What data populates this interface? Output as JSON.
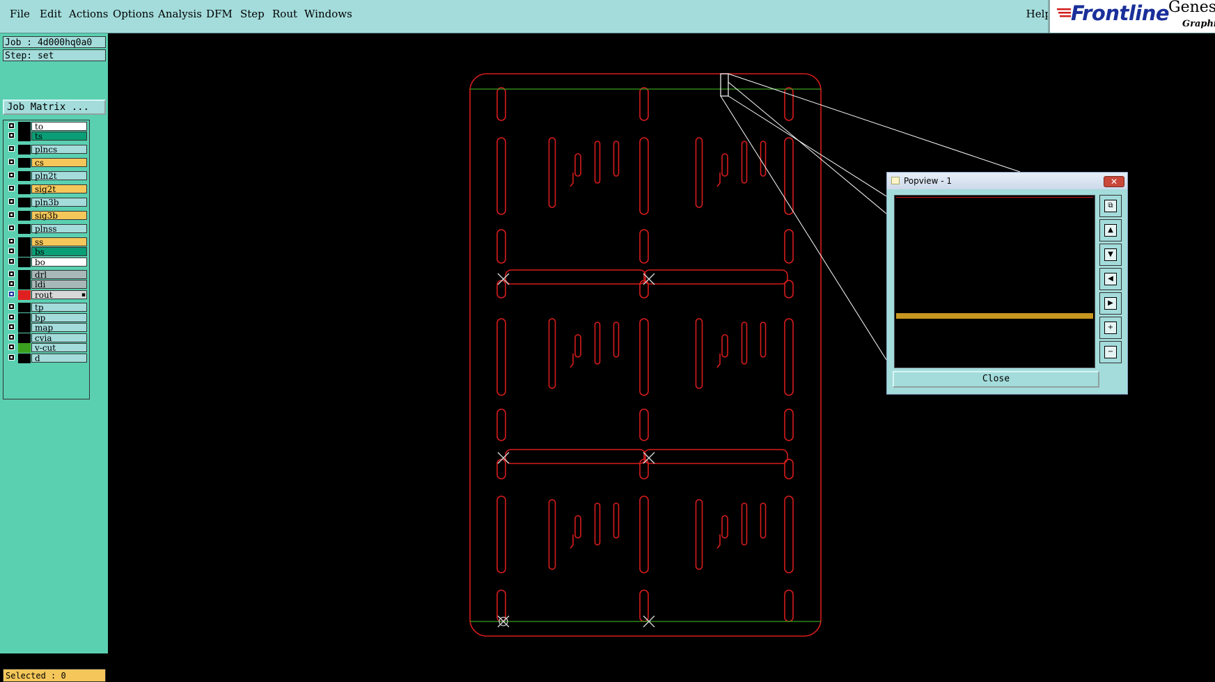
{
  "menu": {
    "file": "File",
    "edit": "Edit",
    "actions": "Actions",
    "options": "Options",
    "analysis": "Analysis",
    "dfm": "DFM",
    "step": "Step",
    "rout": "Rout",
    "windows": "Windows",
    "help": "Help"
  },
  "logo": {
    "brand": "Frontline",
    "product": "Genesis",
    "sub": "Graphic"
  },
  "job": {
    "job_label": "Job : 4d000hq0a0",
    "step_label": "Step: set",
    "job_matrix_button": "Job Matrix ..."
  },
  "layers": [
    {
      "name": "to",
      "name_color": "#ffffff",
      "swatch": "#000000"
    },
    {
      "name": "ts",
      "name_color": "#0a9e76",
      "swatch": "#000000"
    },
    {
      "name": "plncs",
      "name_color": "#a3dcdb",
      "swatch": "#000000"
    },
    {
      "name": "cs",
      "name_color": "#f5c75a",
      "swatch": "#000000"
    },
    {
      "name": "pln2t",
      "name_color": "#a3dcdb",
      "swatch": "#000000"
    },
    {
      "name": "sig2t",
      "name_color": "#f5c75a",
      "swatch": "#000000"
    },
    {
      "name": "pln3b",
      "name_color": "#a3dcdb",
      "swatch": "#000000"
    },
    {
      "name": "sig3b",
      "name_color": "#f5c75a",
      "swatch": "#000000"
    },
    {
      "name": "plnss",
      "name_color": "#a3dcdb",
      "swatch": "#000000"
    },
    {
      "name": "ss",
      "name_color": "#f5c75a",
      "swatch": "#000000"
    },
    {
      "name": "bs",
      "name_color": "#0a9e76",
      "swatch": "#000000"
    },
    {
      "name": "bo",
      "name_color": "#ffffff",
      "swatch": "#000000"
    },
    {
      "name": "drl",
      "name_color": "#a8b8b8",
      "swatch": "#000000"
    },
    {
      "name": "ldi",
      "name_color": "#a8b8b8",
      "swatch": "#000000"
    },
    {
      "name": "rout",
      "name_color": "#d8d8d8",
      "swatch": "#e02020",
      "active": true,
      "marker": "▪"
    },
    {
      "name": "tp",
      "name_color": "#a3dcdb",
      "swatch": "#000000"
    },
    {
      "name": "bp",
      "name_color": "#a3dcdb",
      "swatch": "#000000"
    },
    {
      "name": "map",
      "name_color": "#a3dcdb",
      "swatch": "#000000"
    },
    {
      "name": "cvia",
      "name_color": "#a3dcdb",
      "swatch": "#000000"
    },
    {
      "name": "v-cut",
      "name_color": "#a3dcdb",
      "swatch": "#3aa020"
    },
    {
      "name": "d",
      "name_color": "#a3dcdb",
      "swatch": "#000000"
    }
  ],
  "status": {
    "selected": "Selected : 0"
  },
  "popview": {
    "title": "Popview - 1",
    "close_label": "Close",
    "title_close_glyph": "✕",
    "buttons": [
      {
        "icon": "zoom-fit-icon",
        "glyph": "⧉"
      },
      {
        "icon": "pan-up-icon",
        "glyph": "▲"
      },
      {
        "icon": "pan-down-icon",
        "glyph": "▼"
      },
      {
        "icon": "pan-left-icon",
        "glyph": "◀"
      },
      {
        "icon": "pan-right-icon",
        "glyph": "▶"
      },
      {
        "icon": "zoom-in-icon",
        "glyph": "+"
      },
      {
        "icon": "zoom-out-icon",
        "glyph": "−"
      }
    ]
  },
  "colors": {
    "rout_outline": "#d81c1c",
    "vcut_line": "#3aa020",
    "marker": "#d8d8d8",
    "popview_highlight": "#c6961e",
    "panel_bg": "#5ad0b1",
    "menubar_bg": "#a3dcdb"
  }
}
